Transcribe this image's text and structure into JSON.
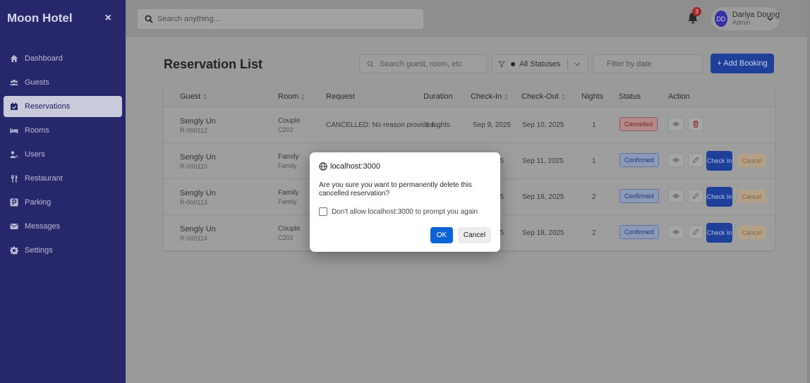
{
  "sidebar": {
    "brand": "Moon Hotel",
    "close_icon": "×",
    "items": [
      {
        "label": "Dashboard",
        "icon": "home-icon"
      },
      {
        "label": "Guests",
        "icon": "guests-icon"
      },
      {
        "label": "Reservations",
        "icon": "calendar-check-icon",
        "active": true
      },
      {
        "label": "Rooms",
        "icon": "bed-icon"
      },
      {
        "label": "Users",
        "icon": "users-icon"
      },
      {
        "label": "Restaurant",
        "icon": "utensils-icon"
      },
      {
        "label": "Parking",
        "icon": "parking-icon"
      },
      {
        "label": "Messages",
        "icon": "envelope-icon"
      },
      {
        "label": "Settings",
        "icon": "gear-icon"
      }
    ]
  },
  "topbar": {
    "search_placeholder": "Search anything...",
    "notification_count": "3",
    "user": {
      "initials": "DD",
      "name": "Dariya Doung",
      "role": "Admin"
    }
  },
  "main": {
    "title": "Reservation List",
    "filter_search_placeholder": "Search guest, room, etc",
    "status_filter": "All Statuses",
    "date_filter_placeholder": "Filter by date",
    "add_button": "+ Add Booking",
    "columns": [
      "Guest",
      "Room",
      "Request",
      "Duration",
      "Check-In",
      "Check-Out",
      "Nights",
      "Status",
      "Action"
    ],
    "rows": [
      {
        "guest": "Sengly Un",
        "id": "R-000112",
        "room_type": "Couple",
        "room_num": "C202",
        "request": "CANCELLED: No reason provided.",
        "duration": "1 nights",
        "checkin": "Sep 9, 2025",
        "checkout": "Sep 10, 2025",
        "nights": "1",
        "status": "Cancelled"
      },
      {
        "guest": "Sengly Un",
        "id": "R-000110",
        "room_type": "Family",
        "room_num": "Family",
        "request": "",
        "duration": "",
        "checkin": "25",
        "checkout": "Sep 11, 2025",
        "nights": "1",
        "status": "Confirmed"
      },
      {
        "guest": "Sengly Un",
        "id": "R-000113",
        "room_type": "Family",
        "room_num": "Family",
        "request": "",
        "duration": "",
        "checkin": "25",
        "checkout": "Sep 18, 2025",
        "nights": "2",
        "status": "Confirmed"
      },
      {
        "guest": "Sengly Un",
        "id": "R-000114",
        "room_type": "Couple",
        "room_num": "C202",
        "request": "",
        "duration": "",
        "checkin": "25",
        "checkout": "Sep 18, 2025",
        "nights": "2",
        "status": "Confirmed"
      }
    ],
    "checkin_label": "Check In",
    "cancel_label": "Cancel"
  },
  "dialog": {
    "origin": "localhost:3000",
    "message": "Are you sure you want to permanently delete this cancelled reservation?",
    "checkbox_label": "Don't allow localhost:3000 to prompt you again",
    "ok": "OK",
    "cancel": "Cancel"
  },
  "colors": {
    "sidebar": "#27286c",
    "primary": "#0b63d6",
    "overlay": "#9a9a9a"
  }
}
